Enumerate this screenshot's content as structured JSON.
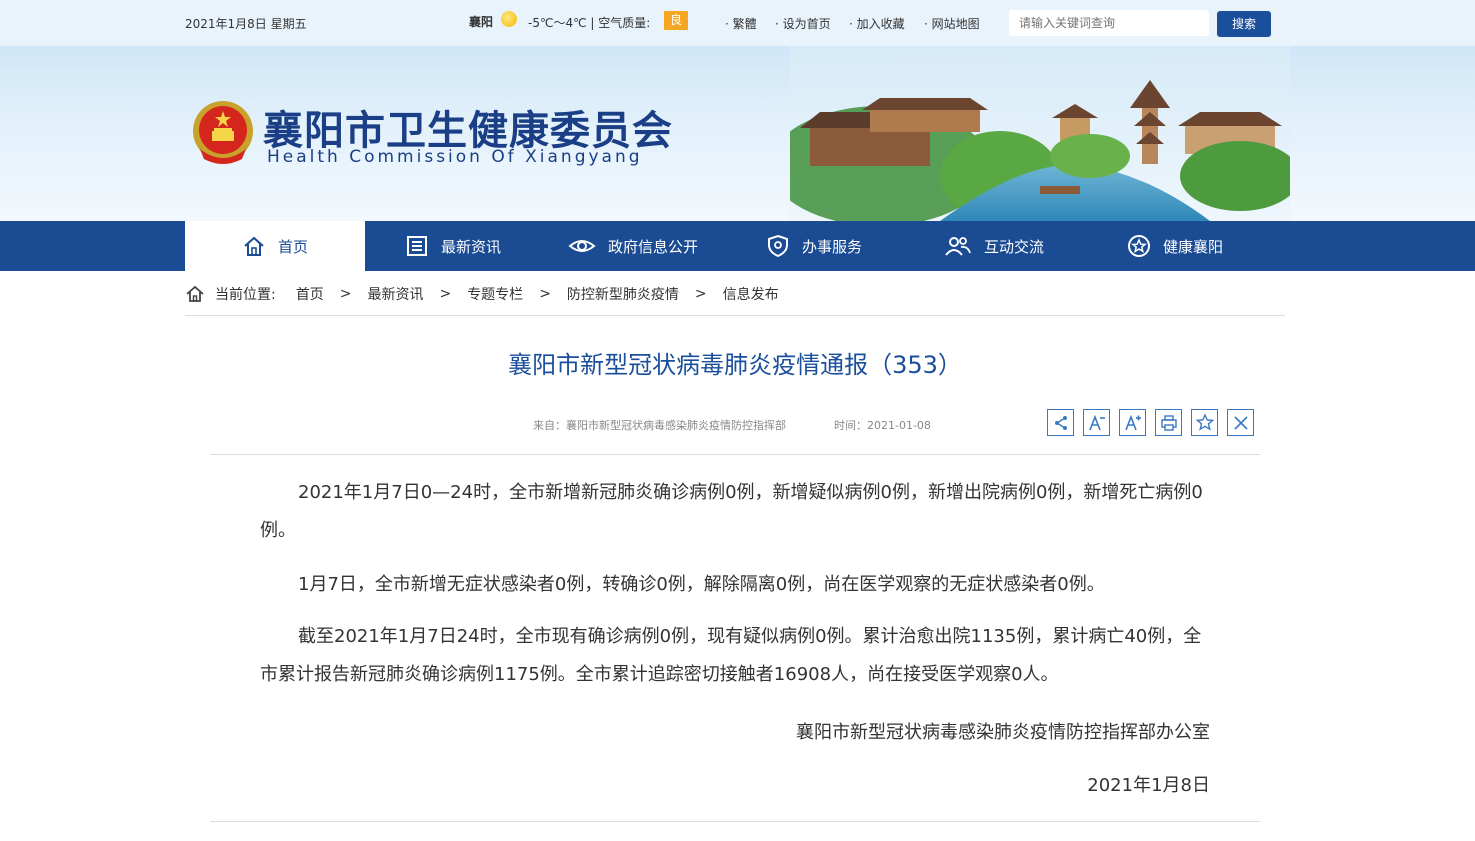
{
  "topbar": {
    "date": "2021年1月8日 星期五",
    "city": "襄阳",
    "weather_icon": "sun-icon",
    "temperature": "-5℃～4℃ | 空气质量:",
    "air_quality": "良",
    "links": [
      "· 繁體",
      "· 设为首页",
      "· 加入收藏",
      "· 网站地图"
    ],
    "search_placeholder": "请输入关键词查询",
    "search_button": "搜索"
  },
  "header": {
    "title": "襄阳市卫生健康委员会",
    "subtitle": "Health Commission Of Xiangyang"
  },
  "nav": [
    {
      "label": "首页",
      "icon": "home-icon"
    },
    {
      "label": "最新资讯",
      "icon": "news-icon"
    },
    {
      "label": "政府信息公开",
      "icon": "eye-icon"
    },
    {
      "label": "办事服务",
      "icon": "shield-icon"
    },
    {
      "label": "互动交流",
      "icon": "people-icon"
    },
    {
      "label": "健康襄阳",
      "icon": "star-icon"
    }
  ],
  "breadcrumb": {
    "prefix": "当前位置:",
    "items": [
      "首页",
      "最新资讯",
      "专题专栏",
      "防控新型肺炎疫情",
      "信息发布"
    ],
    "separator": ">"
  },
  "article": {
    "title": "襄阳市新型冠状病毒肺炎疫情通报（353）",
    "source": "来自：襄阳市新型冠状病毒感染肺炎疫情防控指挥部",
    "time": "时间：2021-01-08",
    "tools": [
      "share-icon",
      "font-decrease-icon",
      "font-increase-icon",
      "print-icon",
      "favorite-icon",
      "close-icon"
    ],
    "paragraphs": [
      "2021年1月7日0—24时，全市新增新冠肺炎确诊病例0例，新增疑似病例0例，新增出院病例0例，新增死亡病例0例。",
      "1月7日，全市新增无症状感染者0例，转确诊0例，解除隔离0例，尚在医学观察的无症状感染者0例。",
      "截至2021年1月7日24时，全市现有确诊病例0例，现有疑似病例0例。累计治愈出院1135例，累计病亡40例，全市累计报告新冠肺炎确诊病例1175例。全市累计追踪密切接触者16908人，尚在接受医学观察0人。"
    ],
    "signature": "襄阳市新型冠状病毒感染肺炎疫情防控指挥部办公室",
    "sign_date": "2021年1月8日"
  },
  "colors": {
    "nav_bg": "#1a4b93",
    "title": "#1b4f9c",
    "badge": "#f5a623"
  }
}
